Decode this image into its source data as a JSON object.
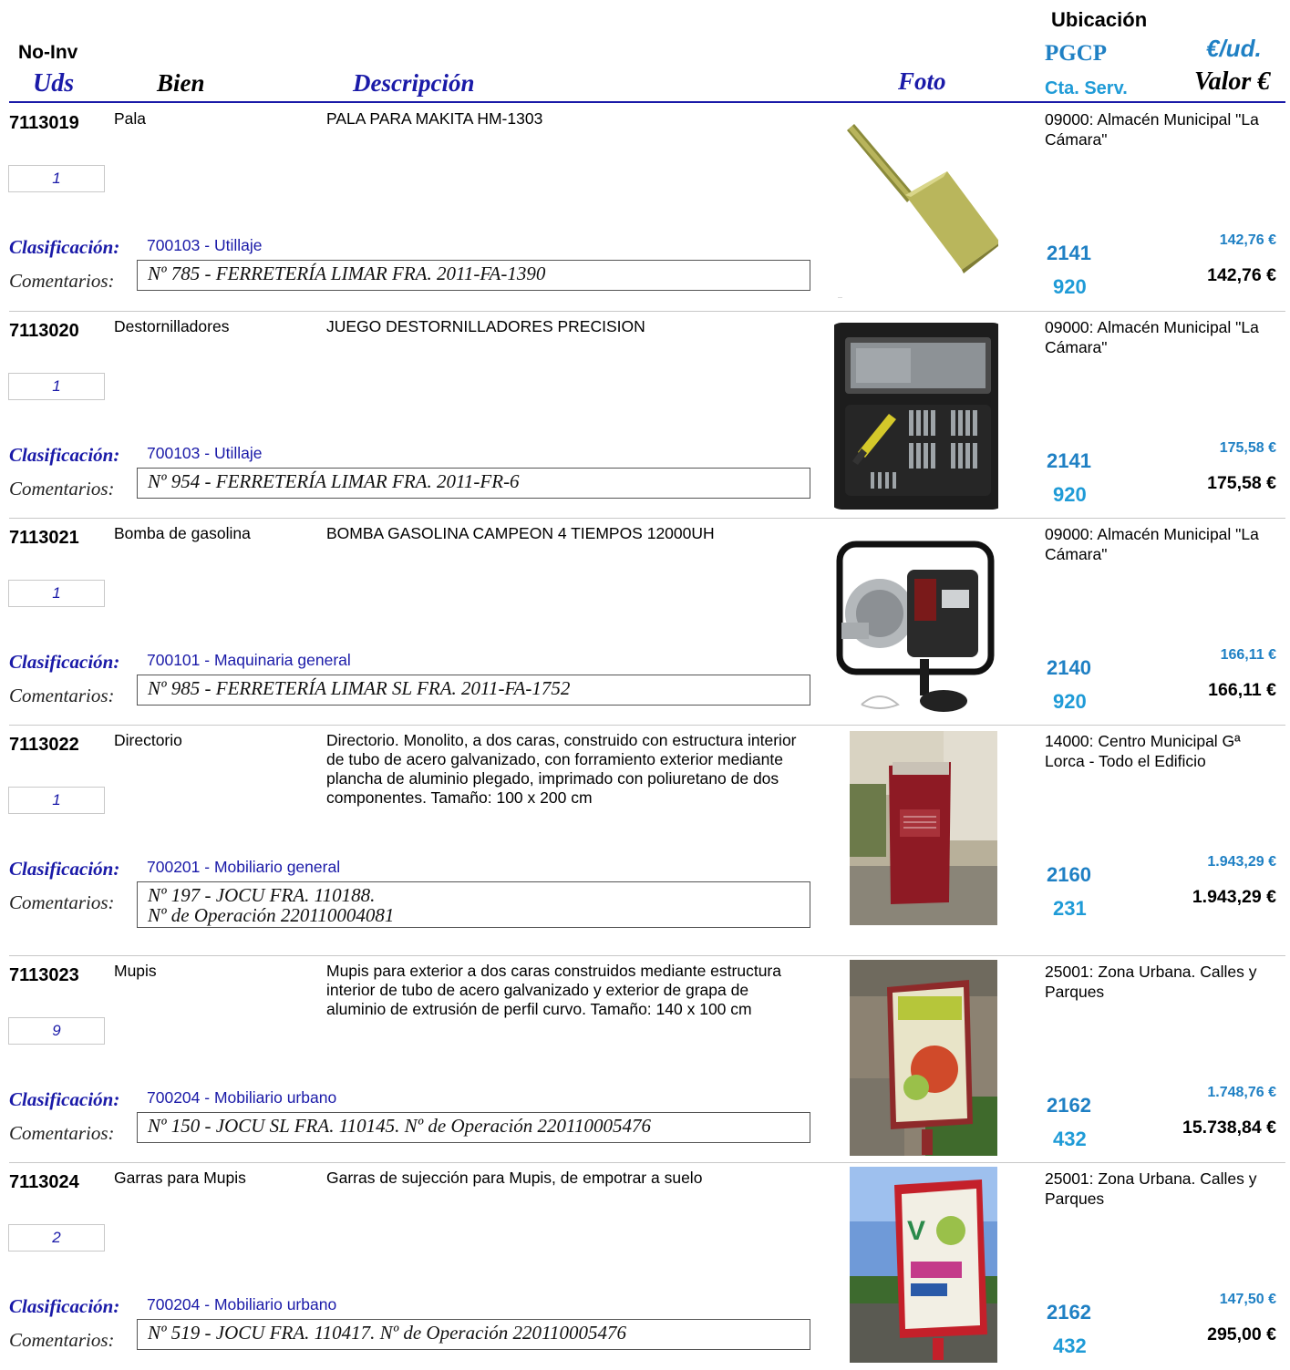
{
  "header": {
    "no_inv": "No-Inv",
    "uds": "Uds",
    "bien": "Bien",
    "descripcion": "Descripción",
    "foto": "Foto",
    "ubicacion": "Ubicación",
    "pgcp": "PGCP",
    "eur_ud": "€/ud.",
    "cta_serv": "Cta. Serv.",
    "valor": "Valor €"
  },
  "labels": {
    "clasificacion": "Clasificación:",
    "comentarios": "Comentarios:"
  },
  "records": [
    {
      "inv": "7113019",
      "bien": "Pala",
      "descripcion": "PALA PARA MAKITA HM-1303",
      "uds": "1",
      "clasificacion": "700103 - Utillaje",
      "comentarios": "Nº 785 - FERRETERÍA LIMAR FRA. 2011-FA-1390",
      "comentarios_2": "",
      "ubicacion": "09000: Almacén Municipal \"La Cámara\"",
      "pgcp": "2141",
      "cta_serv": "920",
      "eur_ud": "142,76 €",
      "valor": "142,76 €",
      "photo_icon": "spade-chisel-photo"
    },
    {
      "inv": "7113020",
      "bien": "Destornilladores",
      "descripcion": "JUEGO DESTORNILLADORES PRECISION",
      "uds": "1",
      "clasificacion": "700103 - Utillaje",
      "comentarios": "Nº 954 - FERRETERÍA LIMAR FRA. 2011-FR-6",
      "comentarios_2": "",
      "ubicacion": "09000: Almacén Municipal \"La Cámara\"",
      "pgcp": "2141",
      "cta_serv": "920",
      "eur_ud": "175,58 €",
      "valor": "175,58 €",
      "photo_icon": "screwdriver-case-photo"
    },
    {
      "inv": "7113021",
      "bien": "Bomba de gasolina",
      "descripcion": "BOMBA GASOLINA CAMPEON 4 TIEMPOS 12000UH",
      "uds": "1",
      "clasificacion": "700101 - Maquinaria general",
      "comentarios": "Nº 985 - FERRETERÍA LIMAR SL FRA. 2011-FA-1752",
      "comentarios_2": "",
      "ubicacion": "09000: Almacén Municipal \"La Cámara\"",
      "pgcp": "2140",
      "cta_serv": "920",
      "eur_ud": "166,11 €",
      "valor": "166,11 €",
      "photo_icon": "water-pump-photo"
    },
    {
      "inv": "7113022",
      "bien": "Directorio",
      "descripcion": "Directorio. Monolito, a dos caras, construido con estructura interior de tubo de acero galvanizado, con forramiento exterior mediante plancha de aluminio plegado,  imprimado con poliuretano de dos componentes. Tamaño: 100 x 200 cm",
      "uds": "1",
      "clasificacion": "700201 - Mobiliario general",
      "comentarios": "Nº 197 - JOCU FRA. 110188.",
      "comentarios_2": "Nº de Operación 220110004081",
      "ubicacion": "14000: Centro Municipal Gª Lorca - Todo el Edificio",
      "pgcp": "2160",
      "cta_serv": "231",
      "eur_ud": "1.943,29 €",
      "valor": "1.943,29 €",
      "photo_icon": "directory-monolith-photo"
    },
    {
      "inv": "7113023",
      "bien": "Mupis",
      "descripcion": "Mupis para exterior a dos caras construidos mediante estructura interior de tubo de acero galvanizado y exterior de grapa de aluminio de extrusión de perfil curvo. Tamaño: 140 x 100 cm",
      "uds": "9",
      "clasificacion": "700204 - Mobiliario urbano",
      "comentarios": "Nº 150 - JOCU SL FRA. 110145. Nº de Operación 220110005476",
      "comentarios_2": "",
      "ubicacion": "25001: Zona Urbana. Calles y Parques",
      "pgcp": "2162",
      "cta_serv": "432",
      "eur_ud": "1.748,76 €",
      "valor": "15.738,84 €",
      "photo_icon": "mupi-street-photo"
    },
    {
      "inv": "7113024",
      "bien": "Garras para Mupis",
      "descripcion": "Garras de sujección para Mupis, de empotrar a suelo",
      "uds": "2",
      "clasificacion": "700204 - Mobiliario urbano",
      "comentarios": "Nº 519 - JOCU FRA. 110417. Nº de Operación 220110005476",
      "comentarios_2": "",
      "ubicacion": "25001: Zona Urbana. Calles y Parques",
      "pgcp": "2162",
      "cta_serv": "432",
      "eur_ud": "147,50 €",
      "valor": "295,00 €",
      "photo_icon": "mupi-park-photo"
    }
  ]
}
